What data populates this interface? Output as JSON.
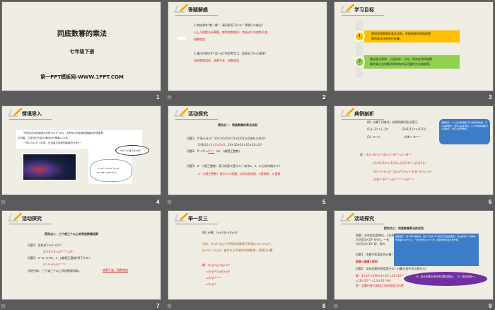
{
  "slides": [
    {
      "number": "1",
      "title": "同底数幂的乘法",
      "subtitle": "七年级下册",
      "footer": "第一PPT模板网-WWW.1PPT.COM"
    },
    {
      "number": "2",
      "header": "答疑解惑",
      "q1": "1.完成课本“做一做”，请问发现了什么？得到什么结论？",
      "a1a": "以上几道题法计算题，都是底数相同；其结论均为底数不变，",
      "a1b": "指数相加",
      "q2": "2.通过对课本中“议一议”的思考学习，你发现了什么规律？",
      "a2": "同底数幂相乘，底数不变，指数相加"
    },
    {
      "number": "3",
      "header": "学习目标",
      "goal1_num": "1",
      "goal1a": "熟知同底数幂的乘法法则，并能熟练的用同底数",
      "goal1b": "幂的乘法法则进行计算。",
      "goal2_num": "2",
      "goal2a": "通过独立思考，小组合作，讨论，探究应用同底数",
      "goal2b": "幂的乘法法则解决简单的实际问题的方法和规律。",
      "colors": {
        "goal1": "#ffc000",
        "goal2": "#92d050"
      }
    },
    {
      "number": "4",
      "header": "情境导入",
      "p1": "光在真空中的速度大约是3×10⁸ m/s。太阳系以外距离地球最近的恒星是",
      "p2": "比邻星，它发出的光到达地球大约需要4.22年。",
      "p3": "一年以3×10⁷ s计算，比邻星与地球的距离约为多少？",
      "bubble1": "10⁸×10⁷等于多少呢？",
      "bubble2a": "3×10⁸×3×10⁷×4.22",
      "bubble2b": "=37.98×(10⁸×10⁷)."
    },
    {
      "number": "5",
      "header": "活动探究",
      "heading": "探究点一：同底数幂的乘法法则",
      "q1": "问题1：2⁵表示什么？10×10×10×10×10可以写成什么形式？",
      "a1a": "2⁵表示",
      "a1b": "2×2×2×2×2，",
      "a1c": "10×10×10×10×10=",
      "a1d": "10⁵",
      "q2a": "问题2：5ᵐ×5ⁿ=",
      "q2b": "5ᵐ⁺ⁿ",
      "q2c": "（m、n都是正整数）",
      "q3": "问题3：aⁿ（n是正整数）表示的意义是什么？其中a、n、aⁿ分别叫做什么？",
      "a3": "aⁿ（n是正整数）表示n个a相乘，其中a是底数，n是指数，aⁿ是幂"
    },
    {
      "number": "6",
      "header": "典例剖析",
      "example": "例1 计算下列各式，结果用幂的形式表示",
      "i1": "(1)(−3)⁷×(−3)⁶",
      "i2": "(2)(1/11)³×(1/11)",
      "i3": "(3)−x³·x⁵",
      "i4": "(4)b²ᵐ·b²ᵐ⁺¹",
      "tip": "温馨提示：1.公式中的底数a可以是具体的数，可以是单项式，也可以是多项式。2.公式中的指数可以是数字，也可以是代数式。",
      "s1": "解：(1)(−3)⁷×(−3)⁶=(−3)⁷⁺⁶=(−3)¹³;",
      "s2": "(2)(1/11)³×(1/11)=(1/11)³⁺¹=(1/11)⁴;",
      "s3": "(3)−x³·x⁵=[(−1)×x³]·x⁵=(−1)(x³·x⁵)=−x⁸;",
      "s4": "(4)b²ᵐ·b²ᵐ⁺¹=b²ᵐ⁺²ᵐ⁺¹=b⁴ᵐ⁺¹."
    },
    {
      "number": "7",
      "header": "活动探究",
      "heading": "探究点二：三个或三个以上的同底数幂相乘",
      "q1": "问题1：怎样求2³×2⁴×2⁵？",
      "a1": "2³×2⁴×2⁵=2³⁺⁴⁺⁵=2¹²",
      "q2": "问题2：aᵐ·aⁿ·aᵖ(m、n、p都是正整数)等于什么？",
      "a2": "aᵐ·aⁿ·aᵖ=aᵐ⁺ⁿ⁺ᵖ",
      "summary": "总结归纳：三个或三个以上同底数幂相乘，",
      "summary_ans": "底数不变，指数相加"
    },
    {
      "number": "8",
      "header": "举一反三",
      "example": "例2 计算：(x-y)²(y-x)(y-x)⁵",
      "analysis1": "分析：(x-y)²与(y-x)不是同底数幂可利用(y-x)²=(x-y)²,",
      "analysis2": "(y-x)⁵=-(x-y)⁵，变为(x-y)为底的同底数幂，再进行计算.",
      "s1": "解：(x-y)²(y-x)(y-x)⁵",
      "s2": "=(x-y)²(x-y)(x-y)⁵",
      "s3": "=(x-y)²⁺¹⁺⁵",
      "s4": "=(x-y)⁸"
    },
    {
      "number": "9",
      "header": "活动探究",
      "heading": "探究点三：同底数幂乘法的应用",
      "ex1": "例题：光年是长度单位，1光年是指光在真空中一年传播的距离，",
      "ex2": "大约是3×10⁵ km/s，一年",
      "ex3": "大约为3×10⁷ 秒，那么",
      "tip": "温馨提示：用“光年”做单位，是为了表示“年”来表示遥远的距离。光在真空中一秒钟大约传播3×10⁵ km，一年大约为3×10⁷ 秒，距离用光年表示更方便。",
      "q1": "问题1：本题中距离如何计算？",
      "a1": "距离=速度×时间",
      "q2": "问题2：实际问题的答案是什么？计算过程中应注意什么？",
      "s1": "解：3×10⁵×200×3×10⁷=18×10¹²",
      "s2": "=18×10⁵⁺⁷=1.8×10¹³km",
      "s3": "答：这颗行星与地球之间的距离大约是",
      "oval": "（1）较大的数应用科学记数法表示；（2）单位应统一。"
    }
  ],
  "anim_icon": "阶"
}
